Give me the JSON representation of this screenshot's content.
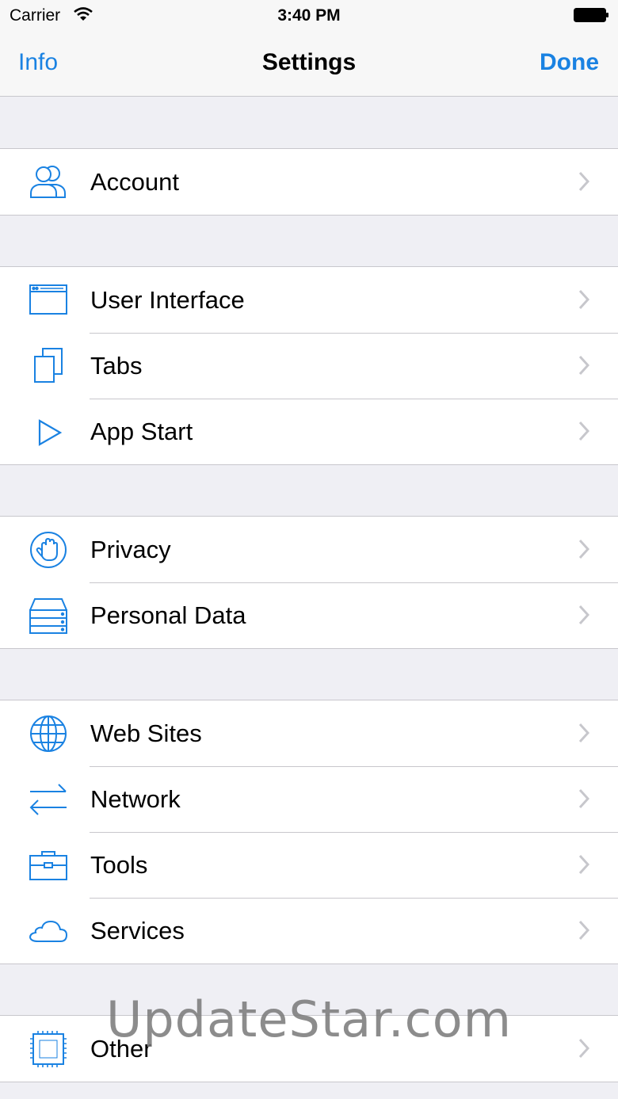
{
  "status_bar": {
    "carrier": "Carrier",
    "time": "3:40 PM"
  },
  "nav": {
    "left": "Info",
    "title": "Settings",
    "right": "Done"
  },
  "colors": {
    "accent": "#1a82e2",
    "background": "#efeff4",
    "separator": "#c8c7cc",
    "chevron": "#c7c7cc"
  },
  "sections": [
    {
      "items": [
        {
          "label": "Account",
          "icon": "account-icon"
        }
      ]
    },
    {
      "items": [
        {
          "label": "User Interface",
          "icon": "window-icon"
        },
        {
          "label": "Tabs",
          "icon": "tabs-icon"
        },
        {
          "label": "App Start",
          "icon": "play-icon"
        }
      ]
    },
    {
      "items": [
        {
          "label": "Privacy",
          "icon": "hand-icon"
        },
        {
          "label": "Personal Data",
          "icon": "storage-icon"
        }
      ]
    },
    {
      "items": [
        {
          "label": "Web Sites",
          "icon": "globe-icon"
        },
        {
          "label": "Network",
          "icon": "arrows-icon"
        },
        {
          "label": "Tools",
          "icon": "toolbox-icon"
        },
        {
          "label": "Services",
          "icon": "cloud-icon"
        }
      ]
    },
    {
      "items": [
        {
          "label": "Other",
          "icon": "chip-icon"
        }
      ]
    }
  ],
  "watermark": "UpdateStar.com"
}
